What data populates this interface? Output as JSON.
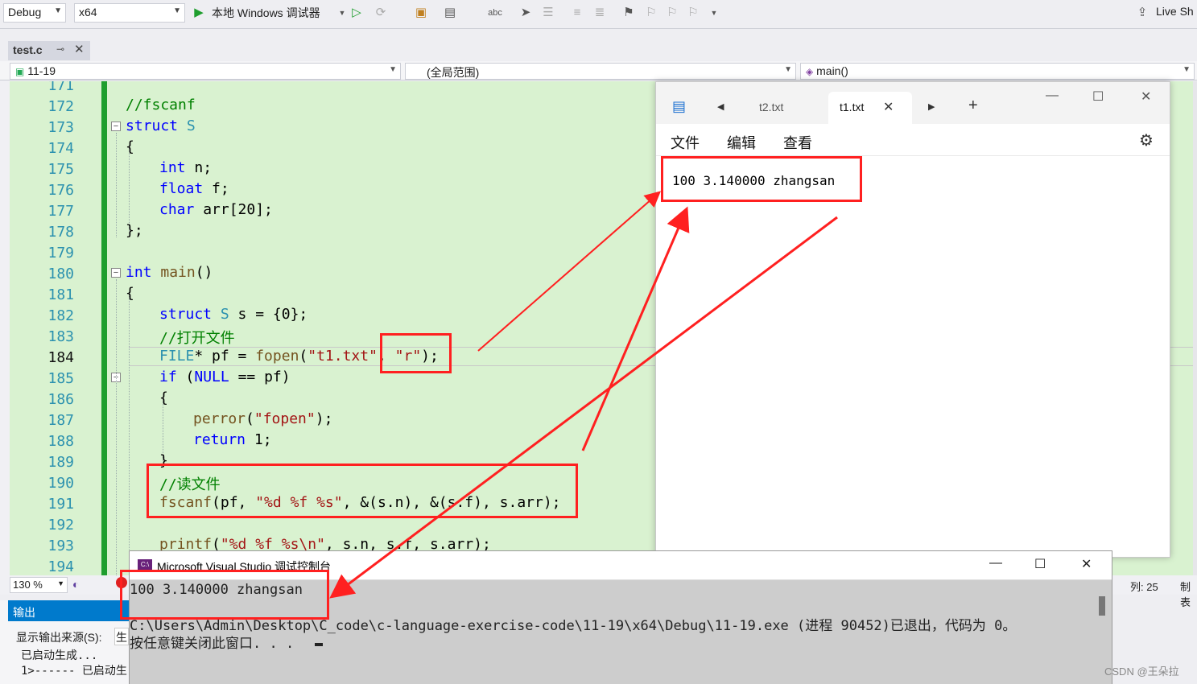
{
  "toolbar": {
    "config": "Debug",
    "platform": "x64",
    "run_label": "本地 Windows 调试器",
    "live_share": "Live Sh"
  },
  "document_tab": {
    "name": "test.c"
  },
  "navbar": {
    "project": "11-19",
    "scope": "(全局范围)",
    "member": "main()"
  },
  "editor": {
    "lines": [
      {
        "num": "171",
        "text": ""
      },
      {
        "num": "172",
        "text": "//fscanf"
      },
      {
        "num": "173",
        "text": "struct S"
      },
      {
        "num": "174",
        "text": "{"
      },
      {
        "num": "175",
        "text": "int n;"
      },
      {
        "num": "176",
        "text": "float f;"
      },
      {
        "num": "177",
        "text": "char arr[20];"
      },
      {
        "num": "178",
        "text": "};"
      },
      {
        "num": "179",
        "text": ""
      },
      {
        "num": "180",
        "text": "int main()"
      },
      {
        "num": "181",
        "text": "{"
      },
      {
        "num": "182",
        "text": "struct S s = {0};"
      },
      {
        "num": "183",
        "text": "//打开文件"
      },
      {
        "num": "184",
        "text": "FILE* pf = fopen(\"t1.txt\", \"r\");"
      },
      {
        "num": "185",
        "text": "if (NULL == pf)"
      },
      {
        "num": "186",
        "text": "{"
      },
      {
        "num": "187",
        "text": "perror(\"fopen\");"
      },
      {
        "num": "188",
        "text": "return 1;"
      },
      {
        "num": "189",
        "text": "}"
      },
      {
        "num": "190",
        "text": "//读文件"
      },
      {
        "num": "191",
        "text": "fscanf(pf, \"%d %f %s\", &(s.n), &(s.f), s.arr);"
      },
      {
        "num": "192",
        "text": ""
      },
      {
        "num": "193",
        "text": "printf(\"%d %f %s\\n\", s.n, s.f, s.arr);"
      },
      {
        "num": "194",
        "text": ""
      }
    ]
  },
  "notepad": {
    "tabs": [
      {
        "label": "t2.txt"
      },
      {
        "label": "t1.txt"
      }
    ],
    "menu": [
      "文件",
      "编辑",
      "查看"
    ],
    "content": "100 3.140000 zhangsan"
  },
  "console": {
    "title": "Microsoft Visual Studio 调试控制台",
    "output_line": "100 3.140000 zhangsan",
    "exit_line": "C:\\Users\\Admin\\Desktop\\C_code\\c-language-exercise-code\\11-19\\x64\\Debug\\11-19.exe (进程 90452)已退出，代码为 0。",
    "prompt_line": "按任意键关闭此窗口. . ."
  },
  "status": {
    "zoom": "130 %",
    "column": "列: 25",
    "extra": "制表"
  },
  "output_panel": {
    "title": "输出",
    "source_label": "显示输出来源(S):",
    "source_value": "生",
    "lines": [
      "已启动生成...",
      "1>------ 已启动生"
    ]
  },
  "watermark": "CSDN @王朵拉",
  "colors": {
    "editor_bg": "#d9f2d0",
    "annotation_red": "#ff2020",
    "accent_blue": "#007acc"
  }
}
